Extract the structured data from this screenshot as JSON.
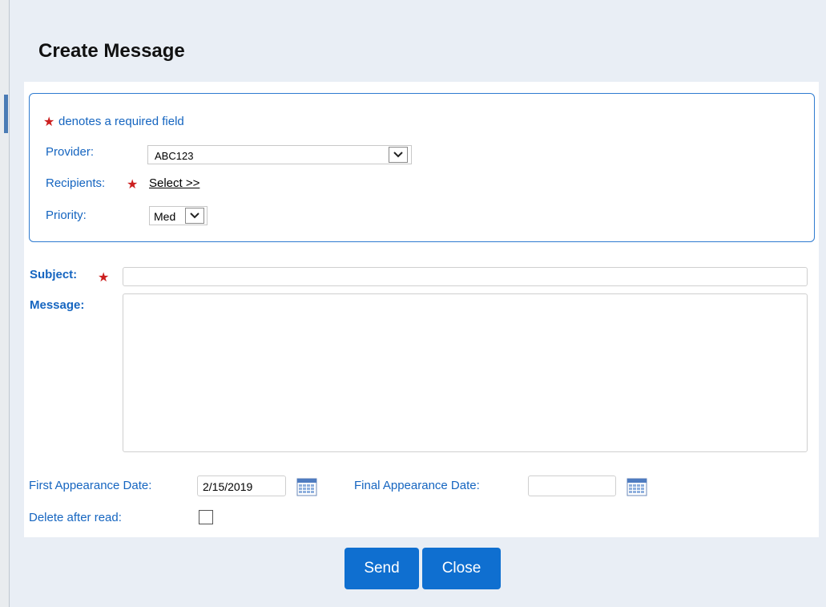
{
  "dialog": {
    "title": "Create Message"
  },
  "form": {
    "required_note": "denotes a required field",
    "provider": {
      "label": "Provider:",
      "value": "ABC123"
    },
    "recipients": {
      "label": "Recipients:",
      "link_label": "Select  >>"
    },
    "priority": {
      "label": "Priority:",
      "value": "Med"
    },
    "subject": {
      "label": "Subject:",
      "value": ""
    },
    "message": {
      "label": "Message:",
      "value": ""
    },
    "first_appearance": {
      "label": "First Appearance Date:",
      "value": "2/15/2019"
    },
    "final_appearance": {
      "label": "Final Appearance Date:",
      "value": ""
    },
    "delete_after_read": {
      "label": "Delete after read:",
      "checked": false
    }
  },
  "buttons": {
    "send_label": "Send",
    "close_label": "Close"
  },
  "colors": {
    "accent": "#0f6fd0",
    "label_blue": "#1565c0",
    "required_star": "#cc1f1f"
  }
}
